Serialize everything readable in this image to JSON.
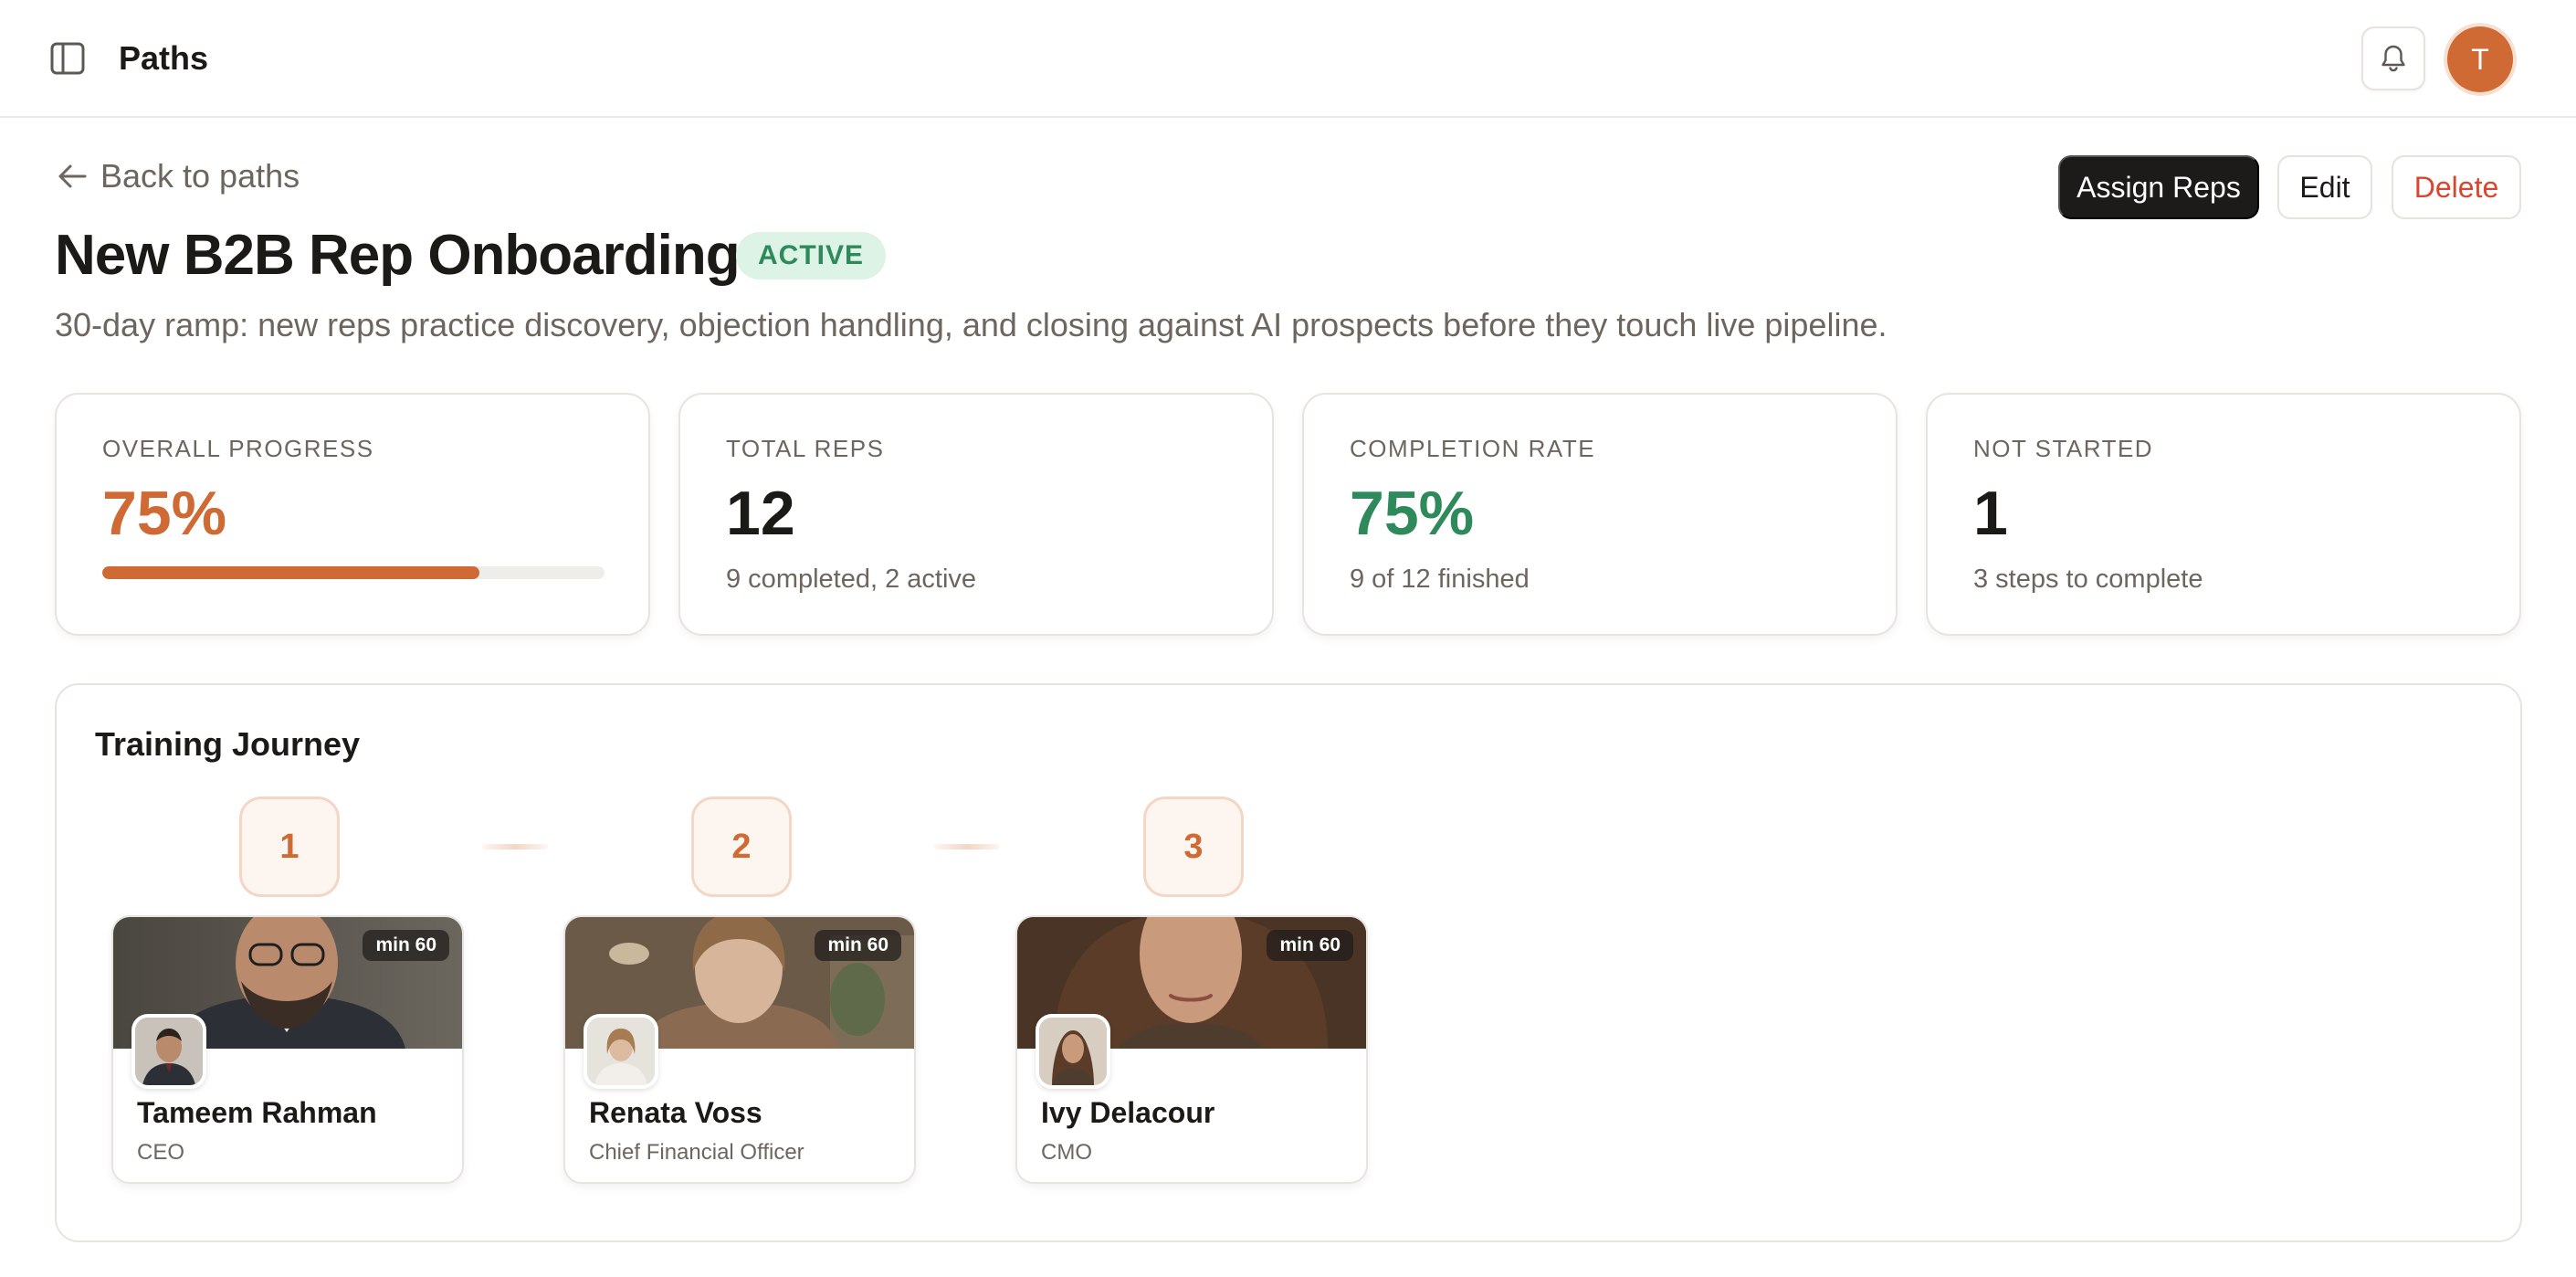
{
  "header": {
    "title": "Paths",
    "avatar_initial": "T"
  },
  "page": {
    "back_label": "Back to paths",
    "title": "New B2B Rep Onboarding",
    "status": "ACTIVE",
    "description": "30-day ramp: new reps practice discovery, objection handling, and closing against AI prospects before they touch live pipeline."
  },
  "actions": {
    "assign": "Assign Reps",
    "edit": "Edit",
    "delete": "Delete"
  },
  "stats": {
    "overall_progress": {
      "label": "OVERALL PROGRESS",
      "value": "75%",
      "fraction": 0.75,
      "color": "#cf6a34"
    },
    "total_reps": {
      "label": "TOTAL REPS",
      "value": "12",
      "sub": "9 completed, 2 active"
    },
    "completion_rate": {
      "label": "COMPLETION RATE",
      "value": "75%",
      "sub": "9 of 12 finished",
      "color": "#2f8a5b"
    },
    "not_started": {
      "label": "NOT STARTED",
      "value": "1",
      "sub": "3 steps to complete"
    }
  },
  "journey": {
    "title": "Training Journey",
    "steps": [
      {
        "number": "1",
        "duration": "min 60",
        "name": "Tameem Rahman",
        "role": "CEO"
      },
      {
        "number": "2",
        "duration": "min 60",
        "name": "Renata Voss",
        "role": "Chief Financial Officer"
      },
      {
        "number": "3",
        "duration": "min 60",
        "name": "Ivy Delacour",
        "role": "CMO"
      }
    ]
  },
  "icons": {
    "sidebar": "sidebar-toggle-icon",
    "bell": "bell-icon",
    "back": "arrow-left-icon"
  }
}
